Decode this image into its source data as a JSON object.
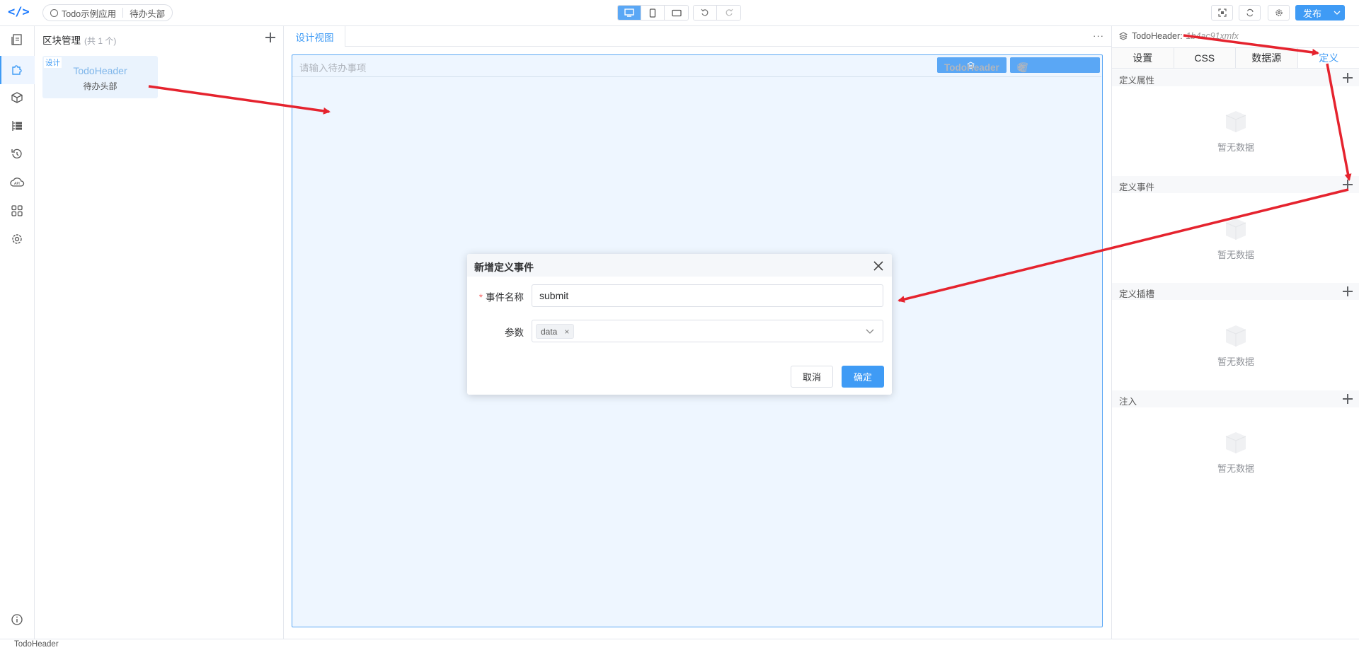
{
  "topbar": {
    "crumb_app": "Todo示例应用",
    "crumb_page": "待办头部",
    "publish_label": "发布"
  },
  "block_panel": {
    "title": "区块管理",
    "count": "(共 1 个)",
    "card": {
      "tag": "设计",
      "name": "TodoHeader",
      "desc": "待办头部"
    }
  },
  "center": {
    "tab_label": "设计视图",
    "more": "···",
    "input_placeholder": "请输入待办事项",
    "component_tag": "TodoHeader"
  },
  "right_panel": {
    "component_name": "TodoHeader:",
    "component_id": "1b4ac91xmfx",
    "tabs": [
      "设置",
      "CSS",
      "数据源",
      "定义"
    ],
    "sections": [
      "定义属性",
      "定义事件",
      "定义插槽",
      "注入"
    ],
    "empty_text": "暂无数据"
  },
  "modal": {
    "title": "新增定义事件",
    "name_label": "事件名称",
    "name_value": "submit",
    "params_label": "参数",
    "params_chips": [
      "data"
    ],
    "cancel_label": "取消",
    "ok_label": "确定"
  },
  "status": {
    "text": "TodoHeader"
  },
  "colors": {
    "accent": "#3f9bf5",
    "arrow": "#e5232e"
  }
}
